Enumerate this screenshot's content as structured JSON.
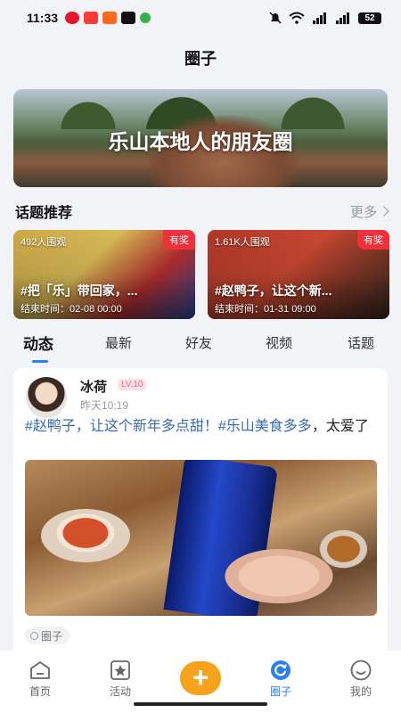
{
  "status": {
    "time": "11:33",
    "battery": "52"
  },
  "page": {
    "title": "圈子"
  },
  "banner": {
    "text": "乐山本地人的朋友圈"
  },
  "topics": {
    "title": "话题推荐",
    "more": "更多",
    "items": [
      {
        "viewers": "492人围观",
        "badge": "有奖",
        "name": "#把「乐」带回家，...",
        "end": "结束时间：02-08 00:00"
      },
      {
        "viewers": "1.61K人围观",
        "badge": "有奖",
        "name": "#赵鸭子，让这个新...",
        "end": "结束时间：01-31 09:00"
      }
    ]
  },
  "tabs": [
    "动态",
    "最新",
    "好友",
    "视频",
    "话题"
  ],
  "post": {
    "user": "冰荷",
    "level": "LV.10",
    "time": "昨天10:19",
    "hashtag1": "#赵鸭子，让这个新年多点甜！",
    "hashtag2": "#乐山美食多多",
    "text": "，太爱了",
    "tag": "圈子"
  },
  "nav": [
    {
      "label": "首页",
      "icon": "home-icon"
    },
    {
      "label": "活动",
      "icon": "activity-icon"
    },
    {
      "label": "",
      "icon": "plus-icon"
    },
    {
      "label": "圈子",
      "icon": "circle-icon"
    },
    {
      "label": "我的",
      "icon": "profile-icon"
    }
  ],
  "colors": {
    "accent": "#2a7ff3",
    "plus": "#f7a21b",
    "badge": "#f0303a",
    "hashtag": "#3a6bb0"
  }
}
